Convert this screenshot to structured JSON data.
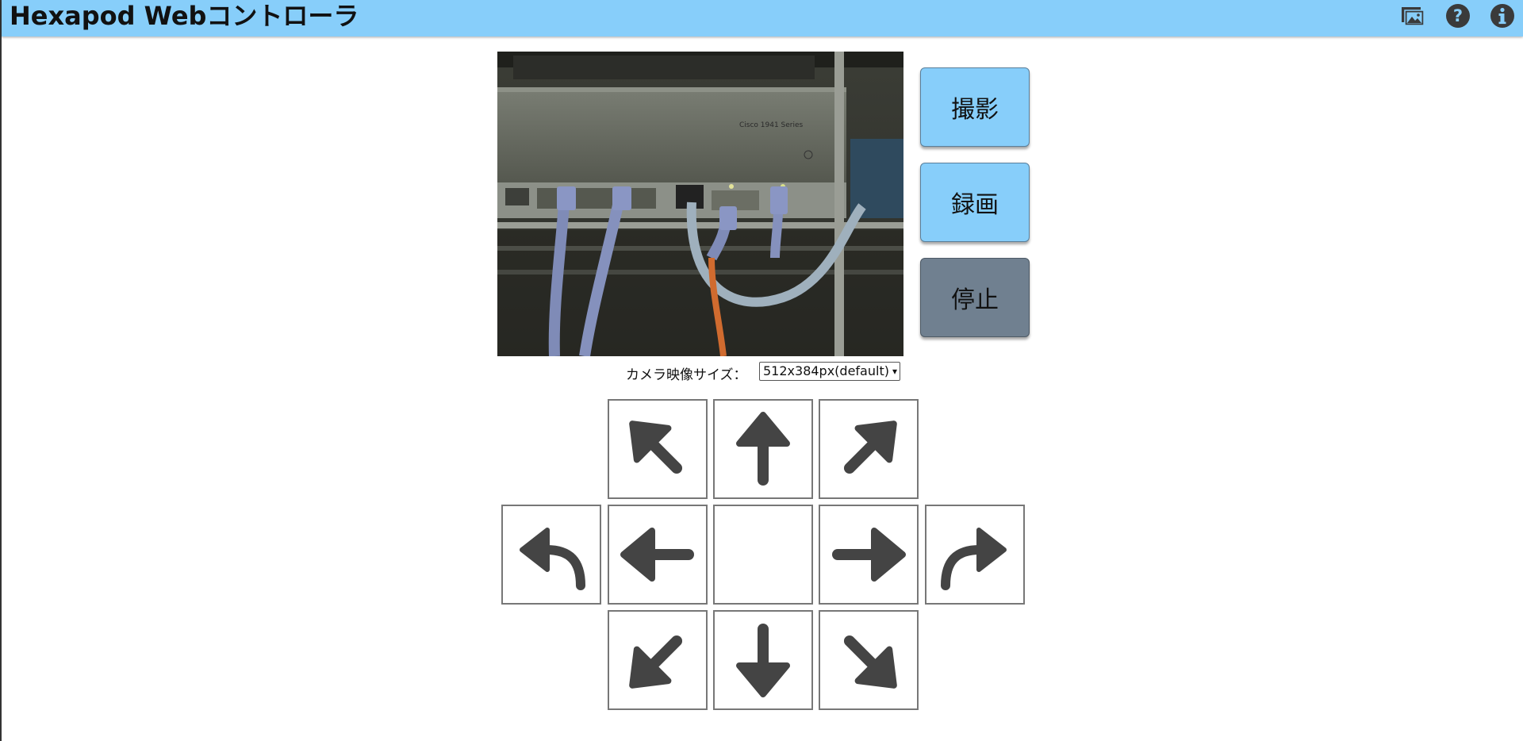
{
  "header": {
    "title": "Hexapod Webコントローラ",
    "bg_color": "#87cefa",
    "icons": [
      "gallery-icon",
      "help-icon",
      "info-icon"
    ]
  },
  "camera": {
    "label_text": "Cisco 1941 Series"
  },
  "actions": {
    "capture_label": "撮影",
    "record_label": "録画",
    "stop_label": "停止",
    "capture_color": "#87cefa",
    "stop_color": "#708090"
  },
  "camera_size": {
    "label": "カメラ映像サイズ：",
    "selected": "512x384px(default)"
  },
  "dpad": {
    "buttons": [
      "forward-left",
      "forward",
      "forward-right",
      "turn-left",
      "left",
      "center",
      "right",
      "turn-right",
      "backward-left",
      "backward",
      "backward-right"
    ],
    "arrow_color": "#444444"
  }
}
